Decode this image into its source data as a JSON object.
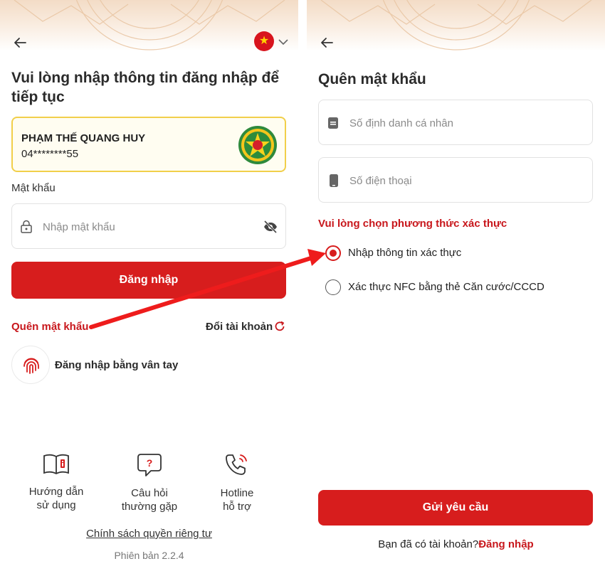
{
  "login": {
    "title": "Vui lòng nhập thông tin đăng nhập để tiếp tục",
    "account_name": "PHẠM THẾ QUANG HUY",
    "account_phone": "04********55",
    "password_label": "Mật khẩu",
    "password_placeholder": "Nhập mật khẩu",
    "login_button": "Đăng nhập",
    "forgot_password": "Quên mật khẩu",
    "switch_account": "Đổi tài khoản",
    "fingerprint_login": "Đăng nhập bằng vân tay",
    "help": [
      {
        "line1": "Hướng dẫn",
        "line2": "sử dụng",
        "icon": "book-icon"
      },
      {
        "line1": "Câu hỏi",
        "line2": "thường gặp",
        "icon": "question-bubble-icon"
      },
      {
        "line1": "Hotline",
        "line2": "hỗ trợ",
        "icon": "phone-icon"
      }
    ],
    "privacy_policy": "Chính sách quyền riêng tư",
    "version": "Phiên bản 2.2.4"
  },
  "forgot": {
    "title": "Quên mật khẩu",
    "id_placeholder": "Số định danh cá nhân",
    "phone_placeholder": "Số điện thoại",
    "method_heading": "Vui lòng chọn phương thức xác thực",
    "options": [
      {
        "label": "Nhập thông tin xác thực",
        "selected": true
      },
      {
        "label": "Xác thực NFC bằng thẻ Căn cước/CCCD",
        "selected": false
      }
    ],
    "submit_button": "Gửi yêu cầu",
    "have_account": "Bạn đã có tài khoản?",
    "login_link": "Đăng nhập"
  },
  "colors": {
    "primary_red": "#d71d1d",
    "highlight_yellow": "#f1cf4a",
    "arrow_red": "#ee1c1c"
  }
}
